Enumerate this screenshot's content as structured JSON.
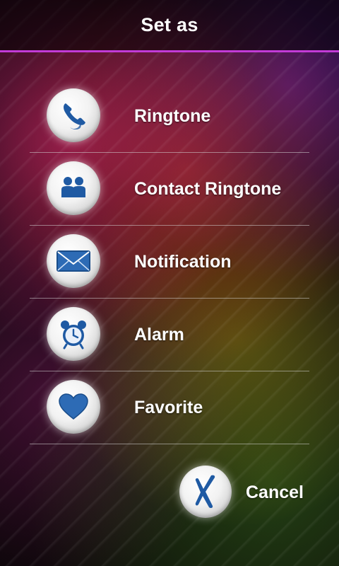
{
  "header": {
    "title": "Set as"
  },
  "menu": {
    "items": [
      {
        "label": "Ringtone",
        "icon": "phone-icon"
      },
      {
        "label": "Contact Ringtone",
        "icon": "contacts-icon"
      },
      {
        "label": "Notification",
        "icon": "envelope-icon"
      },
      {
        "label": "Alarm",
        "icon": "alarm-clock-icon"
      },
      {
        "label": "Favorite",
        "icon": "heart-icon"
      }
    ]
  },
  "cancel": {
    "label": "Cancel",
    "icon": "x-icon"
  },
  "colors": {
    "accent": "#c23bd6",
    "icon_blue": "#2a5fa6"
  }
}
